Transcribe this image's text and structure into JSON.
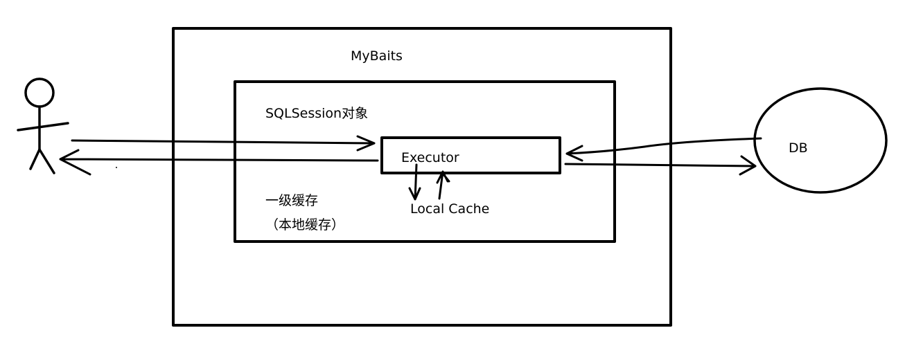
{
  "colors": {
    "background": "#ffffff",
    "ink": "#000000"
  },
  "labels": {
    "mybatis": "MyBaits",
    "sqlsession": "SQLSession对象",
    "executor": "Executor",
    "local_cache": "Local Cache",
    "first_level_cache": "一级缓存",
    "local_cache_cn": "（本地缓存）",
    "db": "DB"
  },
  "icons": {
    "user": "stick-figure-icon",
    "database": "circle-icon"
  }
}
